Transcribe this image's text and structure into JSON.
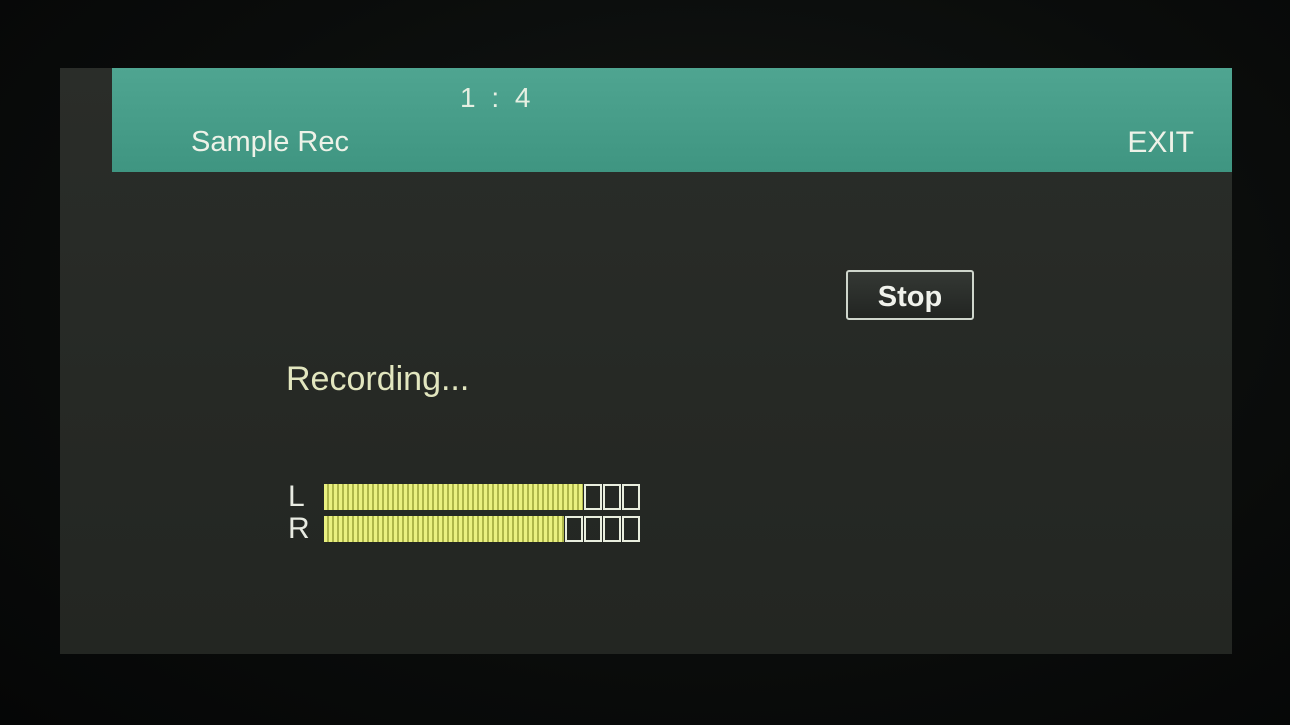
{
  "header": {
    "position": "1 : 4",
    "title": "Sample Rec",
    "exit_label": "EXIT"
  },
  "controls": {
    "stop_label": "Stop"
  },
  "status": {
    "text": "Recording..."
  },
  "meters": {
    "left": {
      "label": "L",
      "level": 0.81
    },
    "right": {
      "label": "R",
      "level": 0.76
    },
    "segments": 16
  },
  "colors": {
    "header_bg": "#46a08b",
    "screen_bg": "#272a26",
    "meter_fill": "#e9f080",
    "status_text": "#e2e6bf"
  }
}
